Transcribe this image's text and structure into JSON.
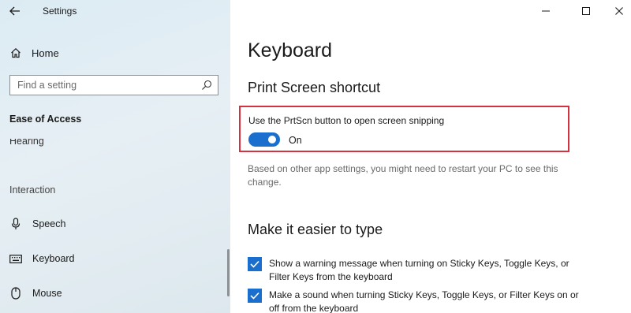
{
  "window": {
    "title": "Settings"
  },
  "sidebar": {
    "home_label": "Home",
    "search_placeholder": "Find a setting",
    "section_heading": "Ease of Access",
    "partial_item": "Hearing",
    "group_label": "Interaction",
    "items": [
      {
        "label": "Speech",
        "icon": "microphone-icon"
      },
      {
        "label": "Keyboard",
        "icon": "keyboard-icon"
      },
      {
        "label": "Mouse",
        "icon": "mouse-icon"
      }
    ]
  },
  "main": {
    "page_title": "Keyboard",
    "print_screen": {
      "heading": "Print Screen shortcut",
      "setting_label": "Use the PrtScn button to open screen snipping",
      "toggle_state": "On",
      "toggle_on": true,
      "note": "Based on other app settings, you might need to restart your PC to see this change."
    },
    "typing": {
      "heading": "Make it easier to type",
      "options": [
        {
          "text": "Show a warning message when turning on Sticky Keys, Toggle Keys, or Filter Keys from the keyboard",
          "checked": true
        },
        {
          "text": "Make a sound when turning Sticky Keys, Toggle Keys, or Filter Keys on or off from the keyboard",
          "checked": true
        }
      ]
    }
  },
  "colors": {
    "accent": "#1a6fce",
    "highlight_border": "#d4323f"
  }
}
